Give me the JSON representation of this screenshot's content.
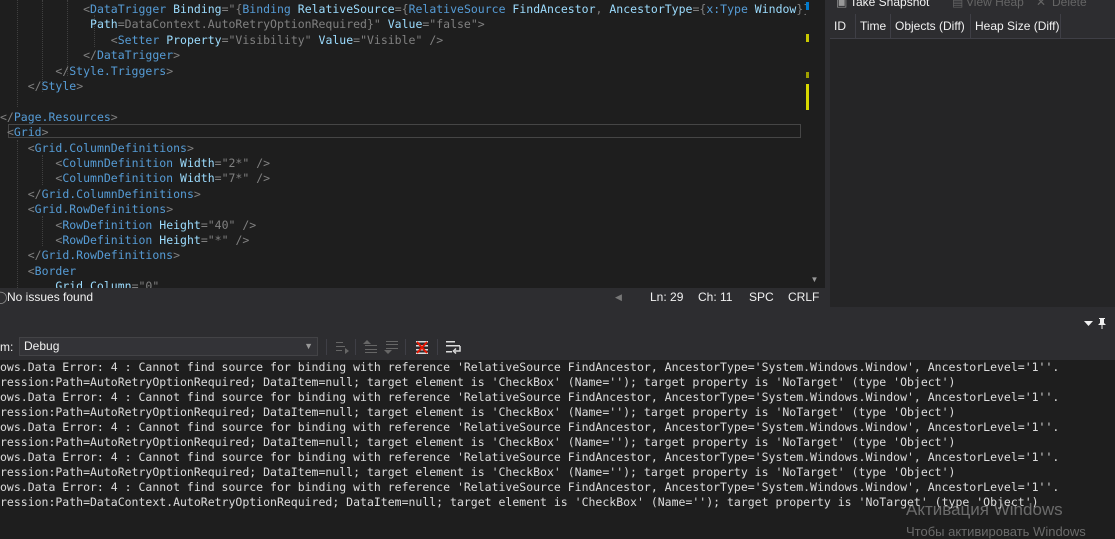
{
  "editor": {
    "lines": [
      [
        [
          "            ",
          "t-k"
        ],
        [
          "<",
          "t-b"
        ],
        [
          "DataTrigger",
          "t-n"
        ],
        [
          " Binding",
          "t-a"
        ],
        [
          "=\"{",
          "t-b"
        ],
        [
          "Binding",
          "t-m"
        ],
        [
          " RelativeSource",
          "t-a"
        ],
        [
          "={",
          "t-b"
        ],
        [
          "RelativeSource",
          "t-m"
        ],
        [
          " FindAncestor",
          "t-a"
        ],
        [
          ", ",
          "t-b"
        ],
        [
          "AncestorType",
          "t-a"
        ],
        [
          "={",
          "t-b"
        ],
        [
          "x:Type",
          "t-m"
        ],
        [
          " Window",
          "t-a"
        ],
        [
          "}},",
          "t-b"
        ]
      ],
      [
        [
          "             ",
          "t-k"
        ],
        [
          "Path",
          "t-a"
        ],
        [
          "=DataContext.AutoRetryOptionRequired}\"",
          "t-b"
        ],
        [
          " Value",
          "t-a"
        ],
        [
          "=\"false\"",
          "t-b"
        ],
        [
          ">",
          "t-b"
        ]
      ],
      [
        [
          "                ",
          "t-k"
        ],
        [
          "<",
          "t-b"
        ],
        [
          "Setter",
          "t-n"
        ],
        [
          " Property",
          "t-a"
        ],
        [
          "=\"Visibility\"",
          "t-b"
        ],
        [
          " Value",
          "t-a"
        ],
        [
          "=\"Visible\"",
          "t-b"
        ],
        [
          " />",
          "t-b"
        ]
      ],
      [
        [
          "            ",
          "t-k"
        ],
        [
          "</",
          "t-b"
        ],
        [
          "DataTrigger",
          "t-n"
        ],
        [
          ">",
          "t-b"
        ]
      ],
      [
        [
          "        ",
          "t-k"
        ],
        [
          "</",
          "t-b"
        ],
        [
          "Style.Triggers",
          "t-n"
        ],
        [
          ">",
          "t-b"
        ]
      ],
      [
        [
          "    ",
          "t-k"
        ],
        [
          "</",
          "t-b"
        ],
        [
          "Style",
          "t-n"
        ],
        [
          ">",
          "t-b"
        ]
      ],
      [
        [
          "",
          "t-k"
        ]
      ],
      [
        [
          "",
          "t-k"
        ],
        [
          "</",
          "t-b"
        ],
        [
          "Page.Resources",
          "t-n"
        ],
        [
          ">",
          "t-b"
        ]
      ],
      [
        [
          " ",
          "t-k"
        ],
        [
          "<",
          "t-b"
        ],
        [
          "Grid",
          "t-n"
        ],
        [
          ">",
          "t-b"
        ]
      ],
      [
        [
          "    ",
          "t-k"
        ],
        [
          "<",
          "t-b"
        ],
        [
          "Grid.ColumnDefinitions",
          "t-n"
        ],
        [
          ">",
          "t-b"
        ]
      ],
      [
        [
          "        ",
          "t-k"
        ],
        [
          "<",
          "t-b"
        ],
        [
          "ColumnDefinition",
          "t-n"
        ],
        [
          " Width",
          "t-a"
        ],
        [
          "=\"2*\"",
          "t-b"
        ],
        [
          " />",
          "t-b"
        ]
      ],
      [
        [
          "        ",
          "t-k"
        ],
        [
          "<",
          "t-b"
        ],
        [
          "ColumnDefinition",
          "t-n"
        ],
        [
          " Width",
          "t-a"
        ],
        [
          "=\"7*\"",
          "t-b"
        ],
        [
          " />",
          "t-b"
        ]
      ],
      [
        [
          "    ",
          "t-k"
        ],
        [
          "</",
          "t-b"
        ],
        [
          "Grid.ColumnDefinitions",
          "t-n"
        ],
        [
          ">",
          "t-b"
        ]
      ],
      [
        [
          "    ",
          "t-k"
        ],
        [
          "<",
          "t-b"
        ],
        [
          "Grid.RowDefinitions",
          "t-n"
        ],
        [
          ">",
          "t-b"
        ]
      ],
      [
        [
          "        ",
          "t-k"
        ],
        [
          "<",
          "t-b"
        ],
        [
          "RowDefinition",
          "t-n"
        ],
        [
          " Height",
          "t-a"
        ],
        [
          "=\"40\"",
          "t-b"
        ],
        [
          " />",
          "t-b"
        ]
      ],
      [
        [
          "        ",
          "t-k"
        ],
        [
          "<",
          "t-b"
        ],
        [
          "RowDefinition",
          "t-n"
        ],
        [
          " Height",
          "t-a"
        ],
        [
          "=\"*\"",
          "t-b"
        ],
        [
          " />",
          "t-b"
        ]
      ],
      [
        [
          "    ",
          "t-k"
        ],
        [
          "</",
          "t-b"
        ],
        [
          "Grid.RowDefinitions",
          "t-n"
        ],
        [
          ">",
          "t-b"
        ]
      ],
      [
        [
          "    ",
          "t-k"
        ],
        [
          "<",
          "t-b"
        ],
        [
          "Border",
          "t-n"
        ]
      ],
      [
        [
          "        ",
          "t-k"
        ],
        [
          "Grid.Column",
          "t-a"
        ],
        [
          "=\"0\"",
          "t-b"
        ]
      ]
    ]
  },
  "editor_status": {
    "issues": "No issues found",
    "line": "Ln: 29",
    "column": "Ch: 11",
    "spacing": "SPC",
    "line_ending": "CRLF"
  },
  "diagnostics": {
    "toolbar": {
      "snapshot": "Take Snapshot",
      "view_heap": "View Heap",
      "delete": "Delete"
    },
    "columns": [
      "ID",
      "Time",
      "Objects (Diff)",
      "Heap Size (Diff)"
    ]
  },
  "output": {
    "show_label": "m:",
    "source": "Debug",
    "lines": [
      "ows.Data Error: 4 : Cannot find source for binding with reference 'RelativeSource FindAncestor, AncestorType='System.Windows.Window', AncestorLevel='1''.",
      "ression:Path=AutoRetryOptionRequired; DataItem=null; target element is 'CheckBox' (Name=''); target property is 'NoTarget' (type 'Object')",
      "ows.Data Error: 4 : Cannot find source for binding with reference 'RelativeSource FindAncestor, AncestorType='System.Windows.Window', AncestorLevel='1''.",
      "ression:Path=AutoRetryOptionRequired; DataItem=null; target element is 'CheckBox' (Name=''); target property is 'NoTarget' (type 'Object')",
      "ows.Data Error: 4 : Cannot find source for binding with reference 'RelativeSource FindAncestor, AncestorType='System.Windows.Window', AncestorLevel='1''.",
      "ression:Path=AutoRetryOptionRequired; DataItem=null; target element is 'CheckBox' (Name=''); target property is 'NoTarget' (type 'Object')",
      "ows.Data Error: 4 : Cannot find source for binding with reference 'RelativeSource FindAncestor, AncestorType='System.Windows.Window', AncestorLevel='1''.",
      "ression:Path=AutoRetryOptionRequired; DataItem=null; target element is 'CheckBox' (Name=''); target property is 'NoTarget' (type 'Object')",
      "ows.Data Error: 4 : Cannot find source for binding with reference 'RelativeSource FindAncestor, AncestorType='System.Windows.Window', AncestorLevel='1''.",
      "ression:Path=DataContext.AutoRetryOptionRequired; DataItem=null; target element is 'CheckBox' (Name=''); target property is 'NoTarget' (type 'Object')"
    ]
  },
  "watermark": {
    "title": "Активация Windows",
    "subtitle": "Чтобы активировать Windows"
  },
  "colors": {
    "background": "#1e1e1e",
    "panel": "#252526",
    "chrome": "#2d2d30",
    "element": "#569cd6",
    "attribute": "#9cdcfe",
    "text": "#dcdcdc"
  }
}
